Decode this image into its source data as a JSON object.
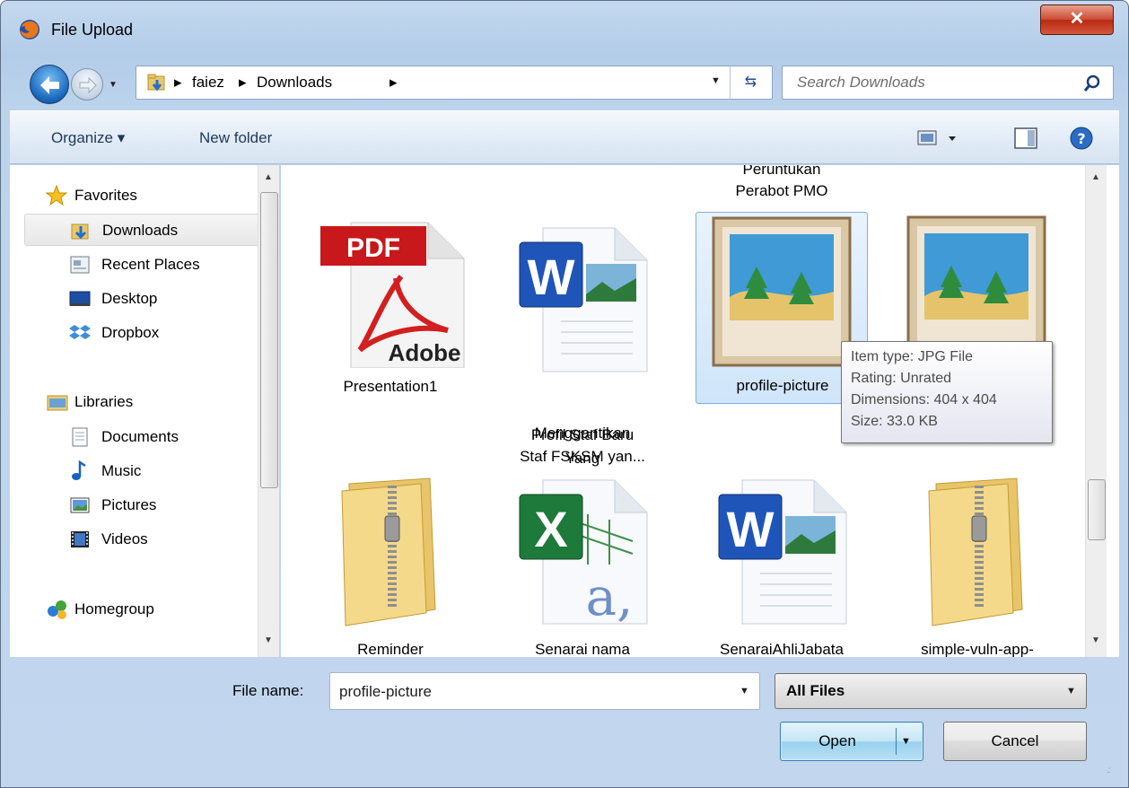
{
  "window": {
    "title": "File Upload"
  },
  "address": {
    "crumbs": [
      "faiez",
      "Downloads"
    ],
    "search_placeholder": "Search Downloads"
  },
  "toolbar": {
    "organize": "Organize ▾",
    "new_folder": "New folder"
  },
  "nav": {
    "favorites": "Favorites",
    "downloads": "Downloads",
    "recent": "Recent Places",
    "desktop": "Desktop",
    "dropbox": "Dropbox",
    "libraries": "Libraries",
    "documents": "Documents",
    "music": "Music",
    "pictures": "Pictures",
    "videos": "Videos",
    "homegroup": "Homegroup"
  },
  "files": {
    "partial_top": [
      "Peruntukan",
      "Perabot PMO"
    ],
    "presentation": "Presentation1",
    "profil": [
      "Profil Staf Baru",
      "Yang",
      "Menggantikan",
      "Staf FSKSM yan..."
    ],
    "profile_picture": "profile-picture",
    "reminder": "Reminder",
    "senarai_nama": "Senarai nama",
    "senarai_ahli": "SenaraiAhliJabata",
    "simple_vuln": "simple-vuln-app-"
  },
  "tooltip": {
    "type": "Item type: JPG File",
    "rating": "Rating: Unrated",
    "dimensions": "Dimensions: 404 x 404",
    "size": "Size: 33.0 KB"
  },
  "bottom": {
    "file_name_label": "File name:",
    "file_name_value": "profile-picture",
    "filter_value": "All Files",
    "open_label": "Open",
    "cancel_label": "Cancel"
  },
  "icons": {
    "pdf_label": "PDF",
    "adobe_label": "Adobe"
  }
}
